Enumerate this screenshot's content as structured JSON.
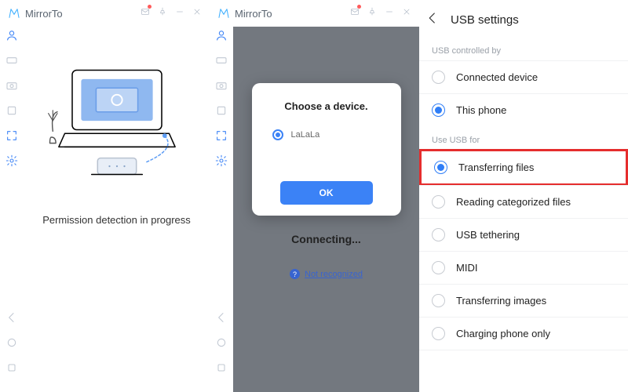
{
  "app": {
    "name": "MirrorTo"
  },
  "left": {
    "status_text": "Permission detection in progress"
  },
  "mid": {
    "dialog_title": "Choose a device.",
    "device_name": "LaLaLa",
    "ok_label": "OK",
    "connecting_label": "Connecting...",
    "not_recognized_label": "Not recognized"
  },
  "right": {
    "title": "USB settings",
    "section_controlled": "USB controlled by",
    "controlled_options": [
      {
        "label": "Connected device",
        "checked": false
      },
      {
        "label": "This phone",
        "checked": true
      }
    ],
    "section_use": "Use USB for",
    "use_options": [
      {
        "label": "Transferring files",
        "checked": true,
        "highlight": true
      },
      {
        "label": "Reading categorized files",
        "checked": false
      },
      {
        "label": "USB tethering",
        "checked": false
      },
      {
        "label": "MIDI",
        "checked": false
      },
      {
        "label": "Transferring images",
        "checked": false
      },
      {
        "label": "Charging phone only",
        "checked": false
      }
    ]
  }
}
